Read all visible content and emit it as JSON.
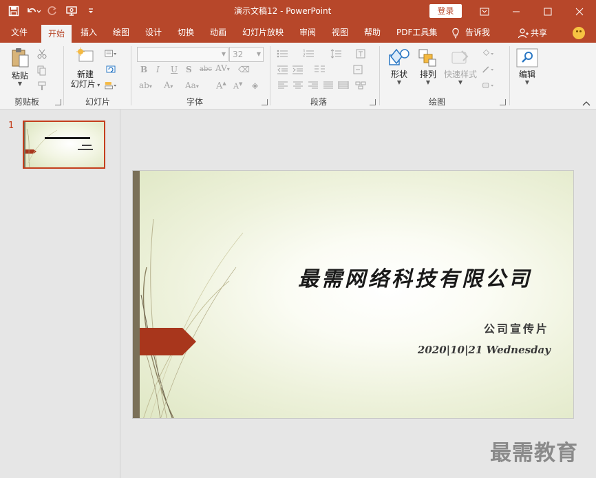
{
  "window": {
    "doc_name": "演示文稿12",
    "separator": " - ",
    "app_name": "PowerPoint",
    "login": "登录",
    "accent": "#b7472a"
  },
  "tabs": [
    "文件",
    "开始",
    "插入",
    "绘图",
    "设计",
    "切换",
    "动画",
    "幻灯片放映",
    "审阅",
    "视图",
    "帮助",
    "PDF工具集"
  ],
  "active_tab": "开始",
  "tell_me": "告诉我",
  "share": "共享",
  "ribbon": {
    "clipboard": {
      "label": "剪贴板",
      "paste": "粘贴"
    },
    "slides": {
      "label": "幻灯片",
      "new_slide_line1": "新建",
      "new_slide_line2": "幻灯片"
    },
    "font": {
      "label": "字体",
      "font_name": "",
      "font_size": "32"
    },
    "paragraph": {
      "label": "段落"
    },
    "drawing": {
      "label": "绘图",
      "shapes": "形状",
      "arrange": "排列",
      "quick_styles": "快速样式"
    },
    "editing": {
      "label": "编辑"
    }
  },
  "slide_panel": {
    "slide_number": "1"
  },
  "slide": {
    "title": "最需网络科技有限公司",
    "subtitle": "公司宣传片",
    "date": "2020|10|21 Wednesday"
  },
  "watermark": "最需教育"
}
